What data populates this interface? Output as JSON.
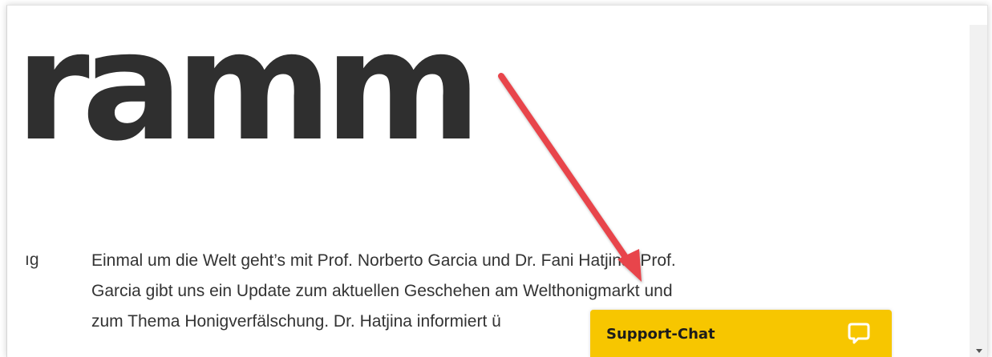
{
  "page": {
    "heading_fragment": "ramm",
    "side_label_fragment": "ıg",
    "paragraph_lines": [
      "Einmal um die Welt geht’s mit Prof. Norberto Garcia und Dr. Fani Hatjina. Prof.",
      "Garcia gibt uns ein Update zum aktuellen Geschehen am Welthonigmarkt und",
      "zum Thema Honigverfälschung. Dr. Hatjina informiert ü"
    ]
  },
  "support_chat": {
    "label": "Support-Chat",
    "icon": "chat-bubble-icon",
    "color": "#f7c600"
  },
  "annotation": {
    "icon": "red-arrow-annotation",
    "color": "#e8454b"
  },
  "colors": {
    "heading": "#2f2f2f",
    "text": "#333333",
    "background": "#ffffff"
  }
}
